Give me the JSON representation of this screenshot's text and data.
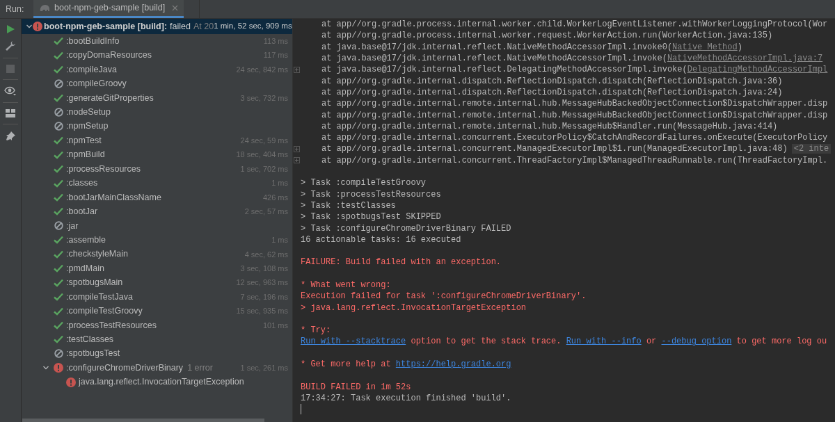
{
  "run_bar": {
    "label": "Run:",
    "tab": {
      "title": "boot-npm-geb-sample [build]",
      "selected": true
    }
  },
  "tree": {
    "root": {
      "name": "boot-npm-geb-sample [build]:",
      "status_text": "failed",
      "time_hint": "At 20",
      "duration": "1 min, 52 sec, 909 ms",
      "kind": "failed",
      "expanded": true,
      "selected": true,
      "children": [
        {
          "name": ":bootBuildInfo",
          "kind": "success",
          "duration": "113 ms"
        },
        {
          "name": ":copyDomaResources",
          "kind": "success",
          "duration": "117 ms"
        },
        {
          "name": ":compileJava",
          "kind": "success",
          "duration": "24 sec, 842 ms"
        },
        {
          "name": ":compileGroovy",
          "kind": "skipped"
        },
        {
          "name": ":generateGitProperties",
          "kind": "success",
          "duration": "3 sec, 732 ms"
        },
        {
          "name": ":nodeSetup",
          "kind": "skipped"
        },
        {
          "name": ":npmSetup",
          "kind": "skipped"
        },
        {
          "name": ":npmTest",
          "kind": "success",
          "duration": "24 sec, 59 ms"
        },
        {
          "name": ":npmBuild",
          "kind": "success",
          "duration": "18 sec, 404 ms"
        },
        {
          "name": ":processResources",
          "kind": "success",
          "duration": "1 sec, 702 ms"
        },
        {
          "name": ":classes",
          "kind": "success",
          "duration": "1 ms"
        },
        {
          "name": ":bootJarMainClassName",
          "kind": "success",
          "duration": "426 ms"
        },
        {
          "name": ":bootJar",
          "kind": "success",
          "duration": "2 sec, 57 ms"
        },
        {
          "name": ":jar",
          "kind": "skipped"
        },
        {
          "name": ":assemble",
          "kind": "success",
          "duration": "1 ms"
        },
        {
          "name": ":checkstyleMain",
          "kind": "success",
          "duration": "4 sec, 62 ms"
        },
        {
          "name": ":pmdMain",
          "kind": "success",
          "duration": "3 sec, 108 ms"
        },
        {
          "name": ":spotbugsMain",
          "kind": "success",
          "duration": "12 sec, 963 ms"
        },
        {
          "name": ":compileTestJava",
          "kind": "success",
          "duration": "7 sec, 196 ms"
        },
        {
          "name": ":compileTestGroovy",
          "kind": "success",
          "duration": "15 sec, 935 ms"
        },
        {
          "name": ":processTestResources",
          "kind": "success",
          "duration": "101 ms"
        },
        {
          "name": ":testClasses",
          "kind": "success"
        },
        {
          "name": ":spotbugsTest",
          "kind": "skipped"
        },
        {
          "name": ":configureChromeDriverBinary",
          "kind": "failed",
          "error_count": "1 error",
          "duration": "1 sec, 261 ms",
          "expanded": true,
          "children": [
            {
              "name": "java.lang.reflect.InvocationTargetException",
              "kind": "failed"
            }
          ]
        }
      ]
    }
  },
  "console": {
    "blocks": [
      {
        "lines": [
          {
            "indent": true,
            "fold": false,
            "error": false,
            "segments": [
              {
                "kind": "text",
                "text": "at app//org.gradle.process.internal.worker.child.WorkerLogEventListener.withWorkerLoggingProtocol(Wor"
              }
            ]
          },
          {
            "indent": true,
            "fold": false,
            "error": false,
            "segments": [
              {
                "kind": "text",
                "text": "at app//org.gradle.process.internal.worker.request.WorkerAction.run(WorkerAction.java:135)"
              }
            ]
          },
          {
            "indent": true,
            "fold": false,
            "error": false,
            "segments": [
              {
                "kind": "text",
                "text": "at java.base@17/jdk.internal.reflect.NativeMethodAccessorImpl.invoke0("
              },
              {
                "kind": "source_link",
                "text": "Native Method"
              },
              {
                "kind": "text",
                "text": ")"
              }
            ]
          },
          {
            "indent": true,
            "fold": false,
            "error": false,
            "segments": [
              {
                "kind": "text",
                "text": "at java.base@17/jdk.internal.reflect.NativeMethodAccessorImpl.invoke("
              },
              {
                "kind": "source_link",
                "text": "NativeMethodAccessorImpl.java:7"
              }
            ]
          },
          {
            "indent": true,
            "fold": true,
            "error": false,
            "segments": [
              {
                "kind": "text",
                "text": "at java.base@17/jdk.internal.reflect.DelegatingMethodAccessorImpl.invoke("
              },
              {
                "kind": "source_link",
                "text": "DelegatingMethodAccessorImpl"
              }
            ]
          },
          {
            "indent": true,
            "fold": false,
            "error": false,
            "segments": [
              {
                "kind": "text",
                "text": "at app//org.gradle.internal.dispatch.ReflectionDispatch.dispatch(ReflectionDispatch.java:36)"
              }
            ]
          },
          {
            "indent": true,
            "fold": false,
            "error": false,
            "segments": [
              {
                "kind": "text",
                "text": "at app//org.gradle.internal.dispatch.ReflectionDispatch.dispatch(ReflectionDispatch.java:24)"
              }
            ]
          },
          {
            "indent": true,
            "fold": false,
            "error": false,
            "segments": [
              {
                "kind": "text",
                "text": "at app//org.gradle.internal.remote.internal.hub.MessageHubBackedObjectConnection$DispatchWrapper.disp"
              }
            ]
          },
          {
            "indent": true,
            "fold": false,
            "error": false,
            "segments": [
              {
                "kind": "text",
                "text": "at app//org.gradle.internal.remote.internal.hub.MessageHubBackedObjectConnection$DispatchWrapper.disp"
              }
            ]
          },
          {
            "indent": true,
            "fold": false,
            "error": false,
            "segments": [
              {
                "kind": "text",
                "text": "at app//org.gradle.internal.remote.internal.hub.MessageHub$Handler.run(MessageHub.java:414)"
              }
            ]
          },
          {
            "indent": true,
            "fold": false,
            "error": false,
            "segments": [
              {
                "kind": "text",
                "text": "at app//org.gradle.internal.concurrent.ExecutorPolicy$CatchAndRecordFailures.onExecute(ExecutorPolicy"
              }
            ]
          },
          {
            "indent": true,
            "fold": true,
            "error": false,
            "segments": [
              {
                "kind": "text",
                "text": "at app//org.gradle.internal.concurrent.ManagedExecutorImpl$1.run(ManagedExecutorImpl.java:48)"
              },
              {
                "kind": "badge",
                "text": "<2 inte"
              }
            ]
          },
          {
            "indent": true,
            "fold": true,
            "error": false,
            "segments": [
              {
                "kind": "text",
                "text": "at app//org.gradle.internal.concurrent.ThreadFactoryImpl$ManagedThreadRunnable.run(ThreadFactoryImpl."
              }
            ]
          }
        ]
      },
      {
        "lines": [
          {
            "indent": false,
            "fold": false,
            "error": false,
            "segments": [
              {
                "kind": "text",
                "text": "> Task :compileTestGroovy"
              }
            ]
          },
          {
            "indent": false,
            "fold": false,
            "error": false,
            "segments": [
              {
                "kind": "text",
                "text": "> Task :processTestResources"
              }
            ]
          },
          {
            "indent": false,
            "fold": false,
            "error": false,
            "segments": [
              {
                "kind": "text",
                "text": "> Task :testClasses"
              }
            ]
          },
          {
            "indent": false,
            "fold": false,
            "error": false,
            "segments": [
              {
                "kind": "text",
                "text": "> Task :spotbugsTest SKIPPED"
              }
            ]
          },
          {
            "indent": false,
            "fold": false,
            "error": false,
            "segments": [
              {
                "kind": "text",
                "text": "> Task :configureChromeDriverBinary FAILED"
              }
            ]
          },
          {
            "indent": false,
            "fold": false,
            "error": false,
            "segments": [
              {
                "kind": "text",
                "text": "16 actionable tasks: 16 executed"
              }
            ]
          }
        ]
      },
      {
        "lines": [
          {
            "indent": false,
            "fold": false,
            "error": true,
            "segments": [
              {
                "kind": "text",
                "text": "FAILURE: Build failed with an exception."
              }
            ]
          }
        ]
      },
      {
        "lines": [
          {
            "indent": false,
            "fold": false,
            "error": true,
            "segments": [
              {
                "kind": "text",
                "text": "* What went wrong:"
              }
            ]
          },
          {
            "indent": false,
            "fold": false,
            "error": true,
            "segments": [
              {
                "kind": "text",
                "text": "Execution failed for task ':configureChromeDriverBinary'."
              }
            ]
          },
          {
            "indent": false,
            "fold": false,
            "error": true,
            "segments": [
              {
                "kind": "text",
                "text": "> java.lang.reflect.InvocationTargetException"
              }
            ]
          }
        ]
      },
      {
        "lines": [
          {
            "indent": false,
            "fold": false,
            "error": true,
            "segments": [
              {
                "kind": "text",
                "text": "* Try:"
              }
            ]
          },
          {
            "indent": false,
            "fold": false,
            "error": true,
            "segments": [
              {
                "kind": "link",
                "text": "Run with --stacktrace"
              },
              {
                "kind": "text",
                "text": " option to get the stack trace. "
              },
              {
                "kind": "link",
                "text": "Run with --info"
              },
              {
                "kind": "text",
                "text": " or "
              },
              {
                "kind": "link",
                "text": "--debug option"
              },
              {
                "kind": "text",
                "text": " to get more log ou"
              }
            ]
          }
        ]
      },
      {
        "lines": [
          {
            "indent": false,
            "fold": false,
            "error": true,
            "segments": [
              {
                "kind": "text",
                "text": "* Get more help at "
              },
              {
                "kind": "link",
                "text": "https://help.gradle.org"
              }
            ]
          }
        ]
      },
      {
        "lines": [
          {
            "indent": false,
            "fold": false,
            "error": true,
            "segments": [
              {
                "kind": "text",
                "text": "BUILD FAILED in 1m 52s"
              }
            ]
          },
          {
            "indent": false,
            "fold": false,
            "error": false,
            "segments": [
              {
                "kind": "text",
                "text": "17:34:27: Task execution finished 'build'."
              }
            ]
          }
        ]
      }
    ]
  }
}
